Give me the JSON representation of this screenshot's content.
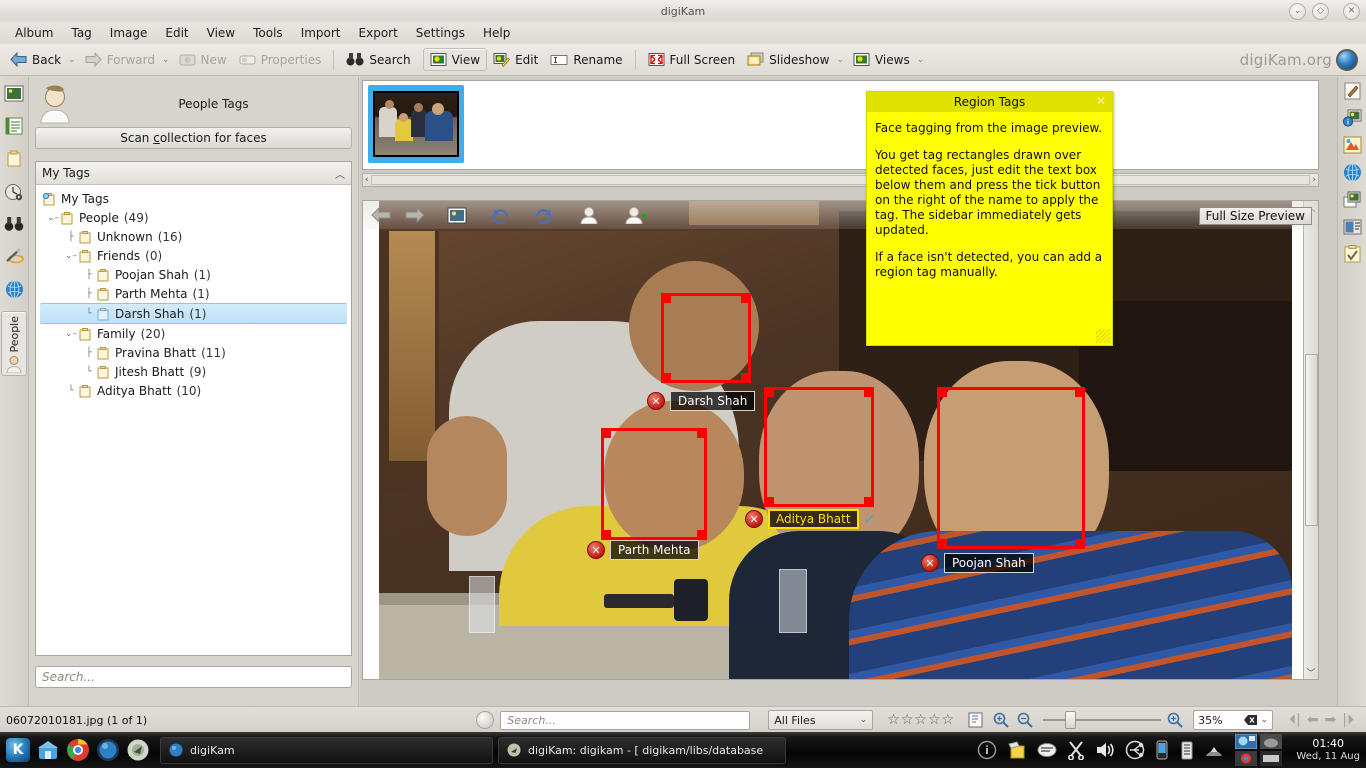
{
  "window": {
    "title": "digiKam",
    "controls": [
      "shade",
      "keep-above",
      "close"
    ]
  },
  "menubar": {
    "items": [
      {
        "label": "Album",
        "accel": "A"
      },
      {
        "label": "Tag",
        "accel": "T"
      },
      {
        "label": "Image",
        "accel": "I"
      },
      {
        "label": "Edit",
        "accel": "E"
      },
      {
        "label": "View",
        "accel": "V"
      },
      {
        "label": "Tools",
        "accel": "T"
      },
      {
        "label": "Import",
        "accel": "I"
      },
      {
        "label": "Export",
        "accel": "E"
      },
      {
        "label": "Settings",
        "accel": "S"
      },
      {
        "label": "Help",
        "accel": "H"
      }
    ]
  },
  "toolbar": {
    "back": "Back",
    "forward": "Forward",
    "new": "New",
    "properties": "Properties",
    "search": "Search",
    "view": "View",
    "edit": "Edit",
    "rename": "Rename",
    "fullscreen": "Full Screen",
    "slideshow": "Slideshow",
    "views": "Views",
    "brand": "digiKam.org"
  },
  "left_strip": {
    "tabs": [
      {
        "name": "albums",
        "icon": "picture-icon"
      },
      {
        "name": "calendar",
        "icon": "list-icon"
      },
      {
        "name": "tags",
        "icon": "tag-icon"
      },
      {
        "name": "timeline",
        "icon": "timeline-icon"
      },
      {
        "name": "searches",
        "icon": "binoculars-icon"
      },
      {
        "name": "fuzzy-search",
        "icon": "magic-wand-icon"
      },
      {
        "name": "map-search",
        "icon": "globe-icon"
      },
      {
        "name": "people",
        "icon": "person-icon",
        "label": "People",
        "active": true
      }
    ]
  },
  "right_strip": {
    "tabs": [
      {
        "name": "properties",
        "icon": "pencil-note-icon"
      },
      {
        "name": "metadata",
        "icon": "info-photo-icon"
      },
      {
        "name": "colors",
        "icon": "color-palette-icon"
      },
      {
        "name": "geolocation",
        "icon": "globe-icon"
      },
      {
        "name": "versions",
        "icon": "photo-stack-icon"
      },
      {
        "name": "captions",
        "icon": "caption-icon"
      },
      {
        "name": "tags",
        "icon": "checkboard-icon"
      }
    ]
  },
  "people_panel": {
    "title": "People Tags",
    "scan_button": "Scan collection for faces",
    "scan_accel": "c",
    "tags_header": "My Tags",
    "tree": [
      {
        "label": "My Tags",
        "count": "",
        "indent": 0,
        "expander": "",
        "root": true,
        "selected": false
      },
      {
        "label": "People",
        "count": "(49)",
        "indent": 1,
        "expander": "v",
        "selected": false
      },
      {
        "label": "Unknown",
        "count": "(16)",
        "indent": 2,
        "expander": "",
        "selected": false
      },
      {
        "label": "Friends",
        "count": "(0)",
        "indent": 2,
        "expander": "v",
        "selected": false
      },
      {
        "label": "Poojan Shah",
        "count": "(1)",
        "indent": 3,
        "expander": "",
        "selected": false
      },
      {
        "label": "Parth Mehta",
        "count": "(1)",
        "indent": 3,
        "expander": "",
        "selected": false
      },
      {
        "label": "Darsh Shah",
        "count": "(1)",
        "indent": 3,
        "expander": "",
        "selected": true
      },
      {
        "label": "Family",
        "count": "(20)",
        "indent": 2,
        "expander": "v",
        "selected": false
      },
      {
        "label": "Pravina Bhatt",
        "count": "(11)",
        "indent": 3,
        "expander": "",
        "selected": false
      },
      {
        "label": "Jitesh Bhatt",
        "count": "(9)",
        "indent": 3,
        "expander": "",
        "selected": false
      },
      {
        "label": "Aditya Bhatt",
        "count": "(10)",
        "indent": 2,
        "expander": "",
        "selected": false
      }
    ],
    "search_placeholder": "Search..."
  },
  "preview": {
    "toolbar_icons": [
      "prev-arrow-icon",
      "next-arrow-icon",
      "image-icon",
      "rotate-left-icon",
      "rotate-right-icon",
      "face-icon",
      "add-face-icon"
    ],
    "fullsize_tooltip": "Full Size Preview",
    "faces": [
      {
        "name": "Darsh Shah",
        "editing": false,
        "has_tick": false
      },
      {
        "name": "Parth Mehta",
        "editing": false,
        "has_tick": false
      },
      {
        "name": "Aditya Bhatt",
        "editing": true,
        "has_tick": true
      },
      {
        "name": "Poojan Shah",
        "editing": false,
        "has_tick": false
      }
    ]
  },
  "note": {
    "title": "Region Tags",
    "paragraphs": [
      "Face tagging from the image preview.",
      "You get tag rectangles drawn over detected faces, just edit the text box below them and press the tick button on the right of the name to apply the tag. The sidebar immediately gets updated.",
      "If a face isn't detected, you can add a region tag manually."
    ],
    "bg_color": "#ffff00"
  },
  "statusbar": {
    "filename": "06072010181.jpg (1 of 1)",
    "search_placeholder": "Search...",
    "filter": "All Files",
    "rating_stars": 5,
    "zoom_level": "35%"
  },
  "taskbar": {
    "launchers": [
      "kde-menu-icon",
      "home-folder-icon",
      "chrome-icon",
      "globe-icon",
      "settings-icon"
    ],
    "tasks": [
      {
        "label": "digiKam",
        "icon": "globe-icon"
      },
      {
        "label": "digiKam:  digikam - [ digikam/libs/database",
        "icon": "konsole-icon"
      }
    ],
    "tray_icons": [
      "info-icon",
      "clipboard-icon",
      "news-icon",
      "scissors-icon",
      "volume-icon",
      "network-icon",
      "phone-icon",
      "battery-icon",
      "arrow-up-icon"
    ],
    "clock_time": "01:40",
    "clock_date": "Wed, 11 Aug"
  },
  "colors": {
    "accent_blue": "#3daee9",
    "face_rect_red": "#fe0000",
    "note_yellow": "#ffff00",
    "selection_blue": "#bfe0f6"
  }
}
